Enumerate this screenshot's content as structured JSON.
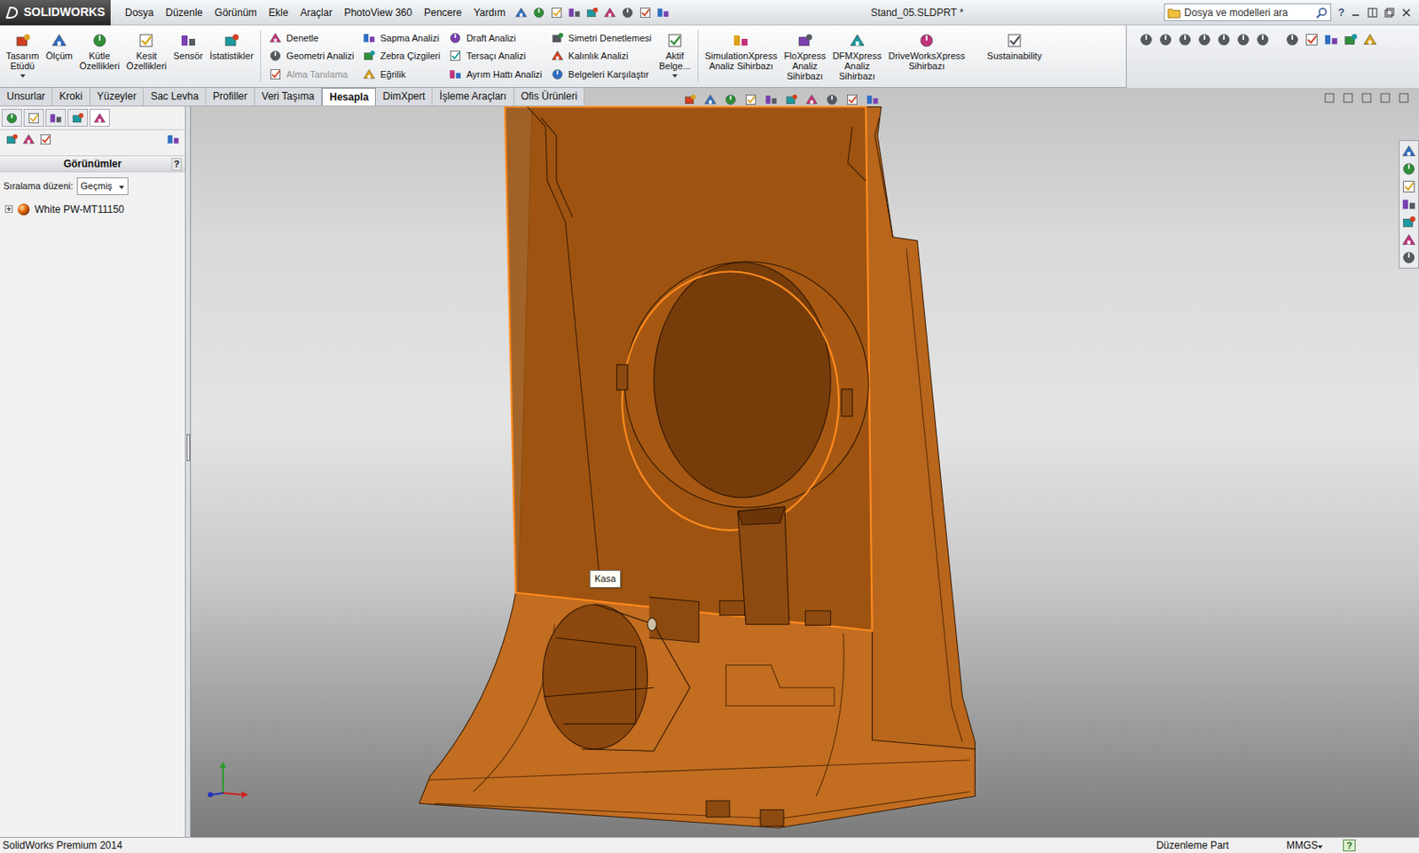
{
  "app": {
    "logo": "SOLIDWORKS",
    "title": "Stand_05.SLDPRT *",
    "help": "?"
  },
  "menu": [
    "Dosya",
    "Düzenle",
    "Görünüm",
    "Ekle",
    "Araçlar",
    "PhotoView 360",
    "Pencere",
    "Yardım"
  ],
  "search": {
    "placeholder": "Dosya ve modelleri ara"
  },
  "ribbon": {
    "left_buttons": [
      {
        "label": "Tasarım\nEtüdü",
        "dropdown": true
      },
      {
        "label": "Ölçüm",
        "dropdown": false
      },
      {
        "label": "Kütle\nÖzellikleri",
        "dropdown": false
      },
      {
        "label": "Kesit\nÖzellikleri",
        "dropdown": false
      },
      {
        "label": "Sensör",
        "dropdown": false
      },
      {
        "label": "İstatistikler",
        "dropdown": false
      }
    ],
    "columns": [
      [
        {
          "label": "Denetle",
          "disabled": false
        },
        {
          "label": "Geometri Analizi",
          "disabled": false
        },
        {
          "label": "Alma Tanılama",
          "disabled": true
        }
      ],
      [
        {
          "label": "Sapma Analizi",
          "disabled": false
        },
        {
          "label": "Zebra Çizgileri",
          "disabled": false
        },
        {
          "label": "Eğrilik",
          "disabled": false
        }
      ],
      [
        {
          "label": "Draft Analizi",
          "disabled": false
        },
        {
          "label": "Tersaçı Analizi",
          "disabled": false
        },
        {
          "label": "Ayrım Hattı Analizi",
          "disabled": false
        }
      ],
      [
        {
          "label": "Simetri Denetlemesi",
          "disabled": false
        },
        {
          "label": "Kalınlık Analizi",
          "disabled": false
        },
        {
          "label": "Belgeleri  Karşılaştır",
          "disabled": false
        }
      ]
    ],
    "active_doc": {
      "label": "Aktif\nBelge...",
      "dropdown": true
    },
    "right_buttons": [
      {
        "label": "SimulationXpress\nAnaliz Sihirbazı"
      },
      {
        "label": "FloXpress\nAnaliz\nSihirbazı"
      },
      {
        "label": "DFMXpress\nAnaliz\nSihirbazı"
      },
      {
        "label": "DriveWorksXpress\nSihirbazı"
      },
      {
        "label": "Sustainability"
      }
    ]
  },
  "tabs": [
    {
      "label": "Unsurlar",
      "selected": false
    },
    {
      "label": "Kroki",
      "selected": false
    },
    {
      "label": "Yüzeyler",
      "selected": false
    },
    {
      "label": "Sac Levha",
      "selected": false
    },
    {
      "label": "Profiller",
      "selected": false
    },
    {
      "label": "Veri Taşıma",
      "selected": false
    },
    {
      "label": "Hesapla",
      "selected": true
    },
    {
      "label": "DimXpert",
      "selected": false
    },
    {
      "label": "İşleme Araçları",
      "selected": false
    },
    {
      "label": "Ofis Ürünleri",
      "selected": false
    }
  ],
  "panel": {
    "tabs": [
      {
        "selected": false
      },
      {
        "selected": false
      },
      {
        "selected": false
      },
      {
        "selected": false
      },
      {
        "selected": true
      }
    ],
    "title": "Görünümler",
    "help": "?",
    "sort_label": "Sıralama düzeni:",
    "sort_value": "Geçmiş",
    "tree": [
      {
        "label": "White PW-MT11150",
        "expanded": false
      }
    ]
  },
  "viewport": {
    "tooltip": "Kasa"
  },
  "status_bar": {
    "product": "SolidWorks Premium 2014",
    "mode": "Düzenleme Part",
    "units": "MMGS",
    "help": "?"
  }
}
